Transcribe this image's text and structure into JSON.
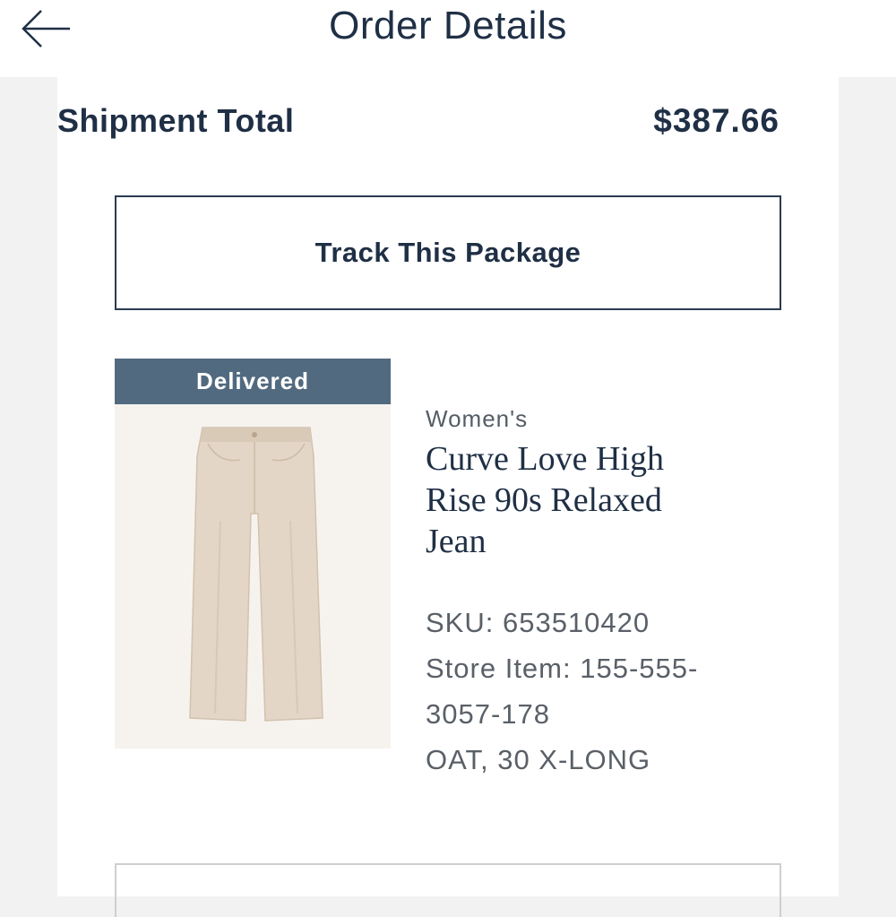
{
  "header": {
    "title": "Order Details",
    "back_icon": "arrow-left-icon"
  },
  "shipment": {
    "label": "Shipment Total",
    "amount": "$387.66"
  },
  "track_button": {
    "label": "Track This Package"
  },
  "item": {
    "status": "Delivered",
    "category": "Women's",
    "name": "Curve Love High Rise 90s Relaxed Jean",
    "sku": "SKU: 653510420",
    "store_item": "Store Item: 155-555-3057-178",
    "variant": "OAT, 30 X-LONG",
    "image": "beige-jeans-image"
  },
  "colors": {
    "text": "#1f2f45",
    "badge": "#526a80",
    "background": "#f2f2f2"
  }
}
